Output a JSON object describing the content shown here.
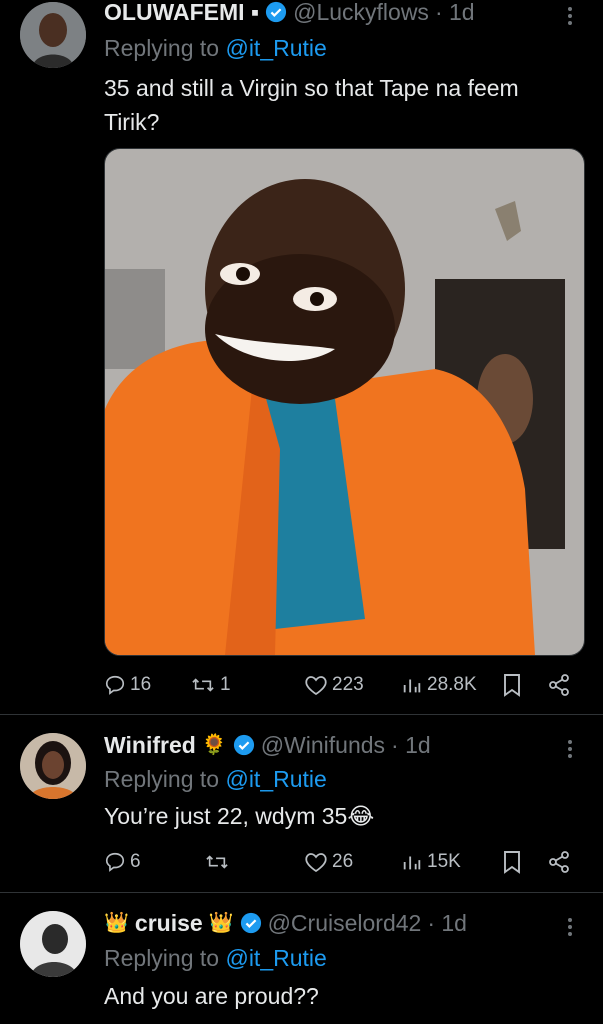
{
  "tweets": [
    {
      "name": "OLUWAFEMI ▪",
      "handle": "@Luckyflows",
      "time": "· 1d",
      "replying_prefix": "Replying to ",
      "replying_to": "@it_Rutie",
      "text": "35 and still a Virgin so that Tape na feem Tirik?",
      "has_media": true,
      "replies": "16",
      "retweets": "1",
      "likes": "223",
      "views": "28.8K"
    },
    {
      "name": "Winifred",
      "name_emoji": "🌻",
      "handle": "@Winifunds",
      "time": "· 1d",
      "replying_prefix": "Replying to ",
      "replying_to": "@it_Rutie",
      "text": "You’re just 22, wdym 35😂",
      "replies": "6",
      "retweets": "",
      "likes": "26",
      "views": "15K"
    },
    {
      "name": "cruise",
      "name_prefix_emoji": "👑",
      "name_emoji": "👑",
      "handle": "@Cruiselord42",
      "time": "· 1d",
      "replying_prefix": "Replying to ",
      "replying_to": "@it_Rutie",
      "text": "And you are proud??"
    }
  ],
  "colors": {
    "background": "#000000",
    "text": "#e7e9ea",
    "muted": "#71767b",
    "accent": "#1d9bf0"
  }
}
